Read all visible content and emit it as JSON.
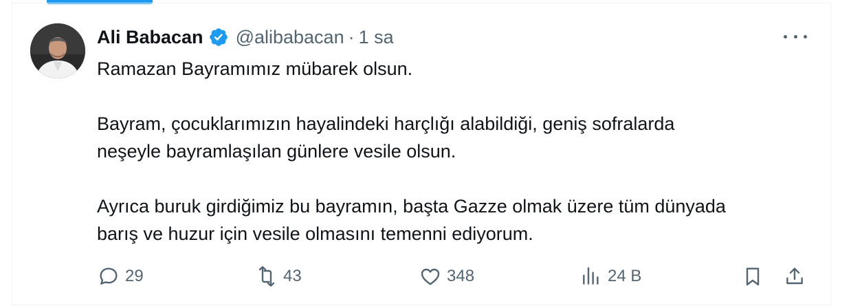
{
  "author": {
    "name": "Ali Babacan",
    "handle": "@alibabacan",
    "separator": "·",
    "time": "1 sa",
    "verified": true
  },
  "tweet": {
    "paragraphs": [
      [
        "Ramazan Bayramımız mübarek olsun."
      ],
      [
        "Bayram, çocuklarımızın hayalindeki harçlığı alabildiği, geniş sofralarda",
        "neşeyle bayramlaşılan günlere vesile olsun."
      ],
      [
        "Ayrıca buruk girdiğimiz bu bayramın, başta Gazze olmak üzere tüm dünyada",
        "barış ve huzur için vesile olmasını temenni ediyorum."
      ]
    ]
  },
  "actions": {
    "replies": "29",
    "reposts": "43",
    "likes": "348",
    "views": "24 B"
  },
  "colors": {
    "accent": "#1d9bf0",
    "text": "#0f1419",
    "muted": "#536471",
    "border": "#eff3f4"
  },
  "icons": [
    "verified-badge-icon",
    "more-icon",
    "reply-icon",
    "repost-icon",
    "like-icon",
    "views-icon",
    "bookmark-icon",
    "share-icon"
  ]
}
